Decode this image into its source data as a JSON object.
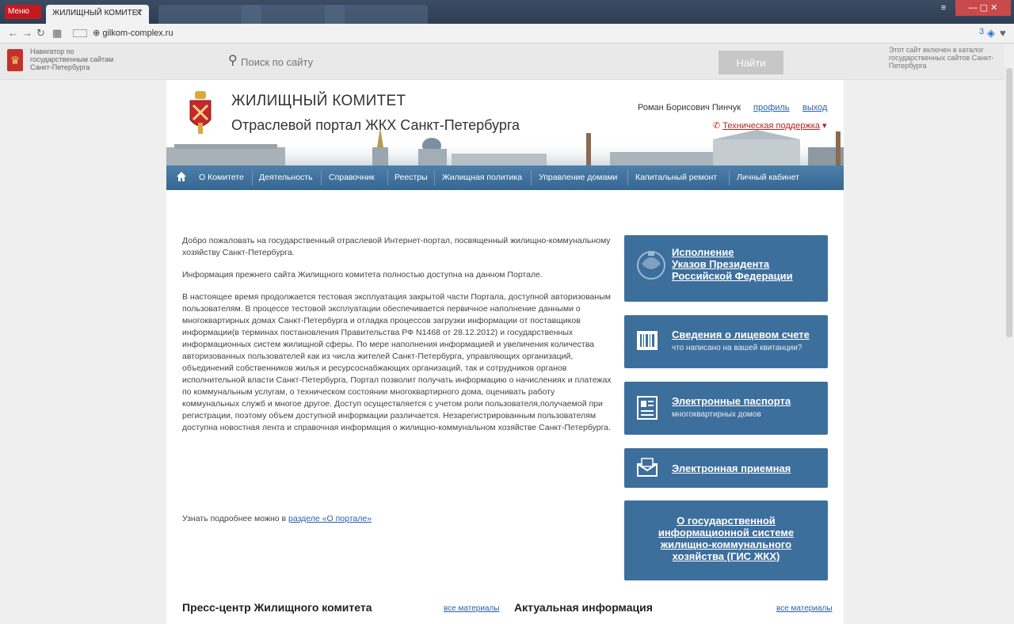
{
  "browser": {
    "menu_label": "Меню",
    "active_tab_title": "ЖИЛИЩНЫЙ КОМИТЕТ",
    "url": "gilkom-complex.ru",
    "counter": "3"
  },
  "gov_strip": {
    "navigator_text": "Навигатор по государственным сайтам Санкт-Петербурга",
    "search_placeholder": "Поиск по сайту",
    "search_button": "Найти",
    "catalog_text": "Этот сайт включен в каталог государственных сайтов Санкт-Петербурга"
  },
  "header": {
    "title": "ЖИЛИЩНЫЙ КОМИТЕТ",
    "subtitle": "Отраслевой портал ЖКХ Санкт-Петербурга",
    "user_name": "Роман Борисович Пинчук",
    "profile_link": "профиль",
    "logout_link": "выход",
    "support": "Техническая поддержка"
  },
  "nav": {
    "items": [
      "О Комитете",
      "Деятельность",
      "Справочник",
      "Реестры",
      "Жилищная политика",
      "Управление домами",
      "Капитальный ремонт",
      "Личный кабинет"
    ]
  },
  "intro": {
    "p1": "Добро пожаловать на государственный отраслевой Интернет-портал, посвященный жилищно-коммунальному хозяйству Санкт-Петербурга.",
    "p2": "Информация прежнего сайта Жилищного комитета полностью доступна на данном Портале.",
    "p3": "В настоящее время продолжается тестовая эксплуатация закрытой  части Портала, доступной авторизованым пользователям. В процессе тестовой эксплуатации обеспечивается первичное наполнение данными о многоквартирных домах Санкт-Петербурга и отладка процессов загрузки информации от поставщиков информации(в терминах постановления Правительства РФ N1468 от 28.12.2012) и государственных информационных систем жилищной сферы. По мере наполнения информацией и увеличения количества авторизованных пользователей как из числа жителей Санкт-Петербурга, управляющих организаций, объединений собственников жилья и ресурсоснабжающих организаций, так и сотрудников органов исполнительной власти Санкт-Петербурга, Портал позволит  получать информацию о  начислениях и платежах по коммунальным услугам, о техническом состоянии многоквартирного дома, оценивать работу коммунальных служб и многое другое. Доступ осуществляется с учетом роли пользователя,получаемой при регистрации, поэтому объем доступной информации различается. Незарегистрированным пользователям доступна новостная лента и справочная информация о жилищно-коммунальном хозяйстве Санкт-Петербурга.",
    "more_prefix": "Узнать подробнее можно в",
    "more_link": "разделе «О портале»"
  },
  "cards": {
    "decrees": {
      "line1": "Исполнение",
      "line2": "Указов Президента",
      "line3": "Российской Федерации"
    },
    "account": {
      "title": "Сведения о лицевом счете",
      "subtitle": "что написано на вашей квитанции?"
    },
    "passports": {
      "title": "Электронные паспорта",
      "subtitle": "многоквартирных домов"
    },
    "reception": {
      "title": "Электронная приемная"
    },
    "gis": {
      "line1": "О государственной",
      "line2": "информационной системе",
      "line3": "жилищно-коммунального",
      "line4": "хозяйства (ГИС ЖКХ)"
    }
  },
  "bottom": {
    "press_title": "Пресс-центр Жилищного комитета",
    "press_all": "все материалы",
    "actual_title": "Актуальная информация",
    "actual_all": "все материалы"
  },
  "colors": {
    "nav_blue": "#366793",
    "card_blue": "#3d6f9d",
    "link_blue": "#2a5fa8",
    "support_red": "#b3261e"
  }
}
